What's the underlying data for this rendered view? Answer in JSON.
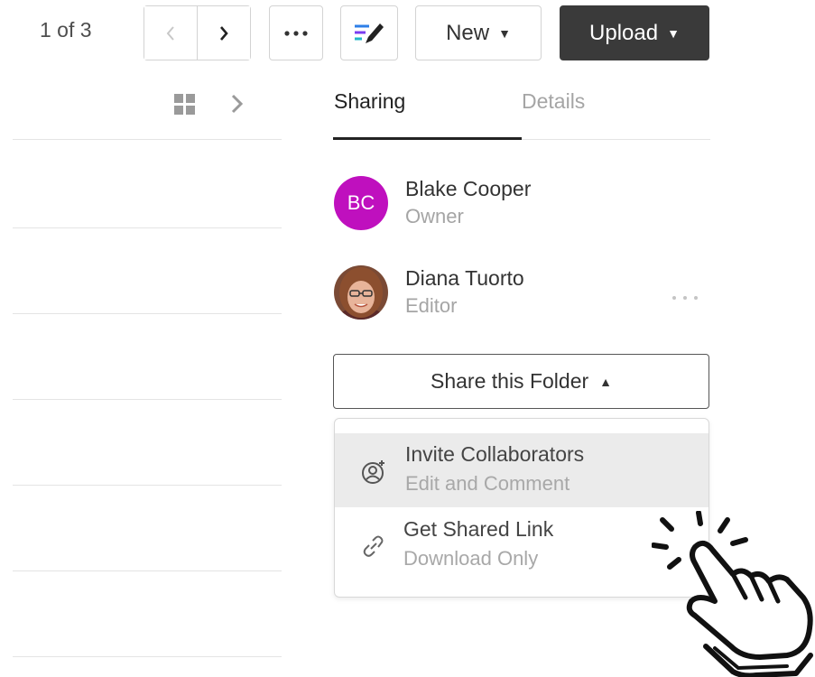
{
  "toolbar": {
    "pager_text": "1 of 3",
    "prev_icon": "chevron-left-icon",
    "next_icon": "chevron-right-icon",
    "more_icon": "ellipsis-icon",
    "annotate_icon": "annotate-pen-icon",
    "new_label": "New",
    "upload_label": "Upload",
    "upload_bg": "#3a3a3a"
  },
  "list": {
    "view_icon": "grid-view-icon",
    "expand_icon": "chevron-right-icon"
  },
  "tabs": [
    {
      "label": "Sharing",
      "active": true
    },
    {
      "label": "Details",
      "active": false
    }
  ],
  "collaborators": [
    {
      "initials": "BC",
      "name": "Blake Cooper",
      "role": "Owner",
      "avatar_color": "#bf10be"
    },
    {
      "name": "Diana Tuorto",
      "role": "Editor",
      "avatar": "photo"
    }
  ],
  "share": {
    "button_label": "Share this Folder",
    "menu": [
      {
        "title": "Invite Collaborators",
        "subtitle": "Edit and Comment",
        "icon": "invite-user-icon",
        "highlighted": true
      },
      {
        "title": "Get Shared Link",
        "subtitle": "Download Only",
        "icon": "link-icon",
        "highlighted": false
      }
    ]
  },
  "overlay": {
    "icon": "tap-hand-icon"
  }
}
